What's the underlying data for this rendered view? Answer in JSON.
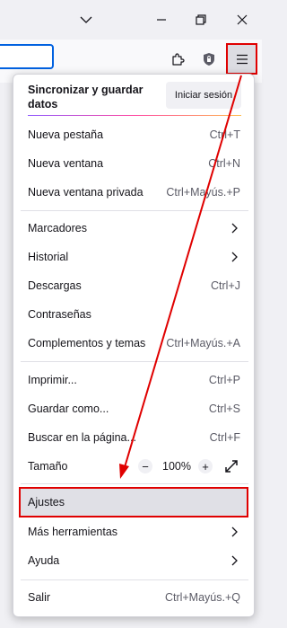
{
  "menu": {
    "sync": {
      "title": "Sincronizar y guardar datos",
      "signin_label": "Iniciar sesión"
    },
    "items": [
      {
        "label": "Nueva pestaña",
        "shortcut": "Ctrl+T"
      },
      {
        "label": "Nueva ventana",
        "shortcut": "Ctrl+N"
      },
      {
        "label": "Nueva ventana privada",
        "shortcut": "Ctrl+Mayús.+P"
      },
      {
        "label": "Marcadores"
      },
      {
        "label": "Historial"
      },
      {
        "label": "Descargas",
        "shortcut": "Ctrl+J"
      },
      {
        "label": "Contraseñas"
      },
      {
        "label": "Complementos y temas",
        "shortcut": "Ctrl+Mayús.+A"
      },
      {
        "label": "Imprimir...",
        "shortcut": "Ctrl+P"
      },
      {
        "label": "Guardar como...",
        "shortcut": "Ctrl+S"
      },
      {
        "label": "Buscar en la página...",
        "shortcut": "Ctrl+F"
      },
      {
        "label": "Tamaño",
        "zoom": "100%"
      },
      {
        "label": "Ajustes"
      },
      {
        "label": "Más herramientas"
      },
      {
        "label": "Ayuda"
      },
      {
        "label": "Salir",
        "shortcut": "Ctrl+Mayús.+Q"
      }
    ]
  },
  "colors": {
    "highlight_border": "#e00000",
    "url_focus": "#0061e0"
  },
  "icons": {
    "titlebar": [
      "chevron-down-icon",
      "minimize-icon",
      "restore-icon",
      "close-icon"
    ],
    "navbar": [
      "extensions-icon",
      "shield-icon",
      "hamburger-menu-icon"
    ]
  }
}
